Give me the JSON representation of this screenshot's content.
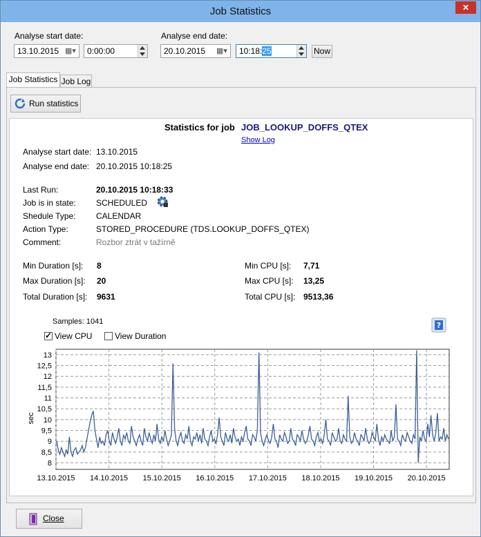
{
  "window": {
    "title": "Job Statistics",
    "close_glyph": "✕"
  },
  "filters": {
    "start_label": "Analyse start date:",
    "start_date": "13.10.2015",
    "start_time": "0:00:00",
    "end_label": "Analyse end date:",
    "end_date": "20.10.2015",
    "end_time_pre": "10:18:",
    "end_time_sel": "25",
    "now_label": "Now"
  },
  "tabs": [
    {
      "label": "Job Statistics"
    },
    {
      "label": "Job Log"
    }
  ],
  "toolbar": {
    "run_label": "Run statistics"
  },
  "stats": {
    "heading_prefix": "Statistics for job",
    "job_name": "JOB_LOOKUP_DOFFS_QTEX",
    "show_log": "Show Log",
    "rows": [
      {
        "label": "Analyse start date:",
        "value": "13.10.2015"
      },
      {
        "label": "Analyse end date:",
        "value": "20.10.2015 10:18:25"
      },
      {
        "label": "Last Run:",
        "value": "20.10.2015 10:18:33"
      },
      {
        "label": "Job is in state:",
        "value": "SCHEDULED"
      },
      {
        "label": "Shedule Type:",
        "value": "CALENDAR"
      },
      {
        "label": "Action Type:",
        "value": "STORED_PROCEDURE (TDS.LOOKUP_DOFFS_QTEX)"
      },
      {
        "label": "Comment:",
        "value": "Rozbor ztrát v tažírně"
      }
    ],
    "metrics": [
      {
        "label": "Min Duration [s]:",
        "value": "8"
      },
      {
        "label": "Max Duration [s]:",
        "value": "20"
      },
      {
        "label": "Total Duration [s]:",
        "value": "9631"
      },
      {
        "label": "Min CPU [s]:",
        "value": "7,71"
      },
      {
        "label": "Max CPU [s]:",
        "value": "13,25"
      },
      {
        "label": "Total CPU [s]:",
        "value": "9513,36"
      }
    ]
  },
  "samples_label": "Samples: 1041",
  "view_cpu_label": "View CPU",
  "view_cpu_checked": true,
  "view_duration_label": "View Duration",
  "view_duration_checked": false,
  "footer": {
    "close_label": "Close"
  },
  "colors": {
    "series": "#3a5f9a",
    "titlebar": "#7eb4ea",
    "link": "#0000cc"
  },
  "chart_data": {
    "type": "line",
    "ylabel": "sec",
    "ylim": [
      7.7,
      13.25
    ],
    "yticks": [
      "8",
      "8,5",
      "9",
      "9,5",
      "10",
      "10,5",
      "11",
      "11,5",
      "12",
      "12,5",
      "13"
    ],
    "x_dates": [
      "13.10.2015",
      "14.10.2015",
      "15.10.2015",
      "16.10.2015",
      "17.10.2015",
      "18.10.2015",
      "19.10.2015",
      "20.10.2015"
    ],
    "xlim": [
      "13.10.2015 00:00",
      "20.10.2015 10:18"
    ],
    "series": [
      {
        "values": [
          9.0,
          8.6,
          8.4,
          8.7,
          8.5,
          8.3,
          8.6,
          8.4,
          9.2,
          8.5,
          8.3,
          8.6,
          8.7,
          8.4,
          8.5,
          8.6,
          8.8,
          8.5,
          8.7,
          9.1,
          9.5,
          9.9,
          10.2,
          10.4,
          9.5,
          9.1,
          8.7,
          9.2,
          8.9,
          9.0,
          8.8,
          9.3,
          9.5,
          9.0,
          8.8,
          9.4,
          9.1,
          8.9,
          9.2,
          9.6,
          9.0,
          8.8,
          9.3,
          9.1,
          9.4,
          9.0,
          8.9,
          9.7,
          9.2,
          9.0,
          8.8,
          9.1,
          9.3,
          9.0,
          8.8,
          9.6,
          9.2,
          9.0,
          9.4,
          9.1,
          8.9,
          9.3,
          9.0,
          9.8,
          9.1,
          8.9,
          9.2,
          9.0,
          9.5,
          9.1,
          8.8,
          9.0,
          9.3,
          12.6,
          9.6,
          9.0,
          8.8,
          9.2,
          9.4,
          9.0,
          8.9,
          9.3,
          9.1,
          9.7,
          9.0,
          8.8,
          9.2,
          9.1,
          9.4,
          9.0,
          9.3,
          8.9,
          9.6,
          9.1,
          9.0,
          8.8,
          9.2,
          9.5,
          9.0,
          9.1,
          8.9,
          9.3,
          10.1,
          9.2,
          9.0,
          8.8,
          9.4,
          9.1,
          9.0,
          9.3,
          8.9,
          9.6,
          9.2,
          9.0,
          9.1,
          8.8,
          9.2,
          9.0,
          9.4,
          9.7,
          9.1,
          9.0,
          8.8,
          9.3,
          9.2,
          9.0,
          9.5,
          13.1,
          9.4,
          9.0,
          8.8,
          9.1,
          9.3,
          9.0,
          8.9,
          9.2,
          9.8,
          9.1,
          9.0,
          8.7,
          9.3,
          9.1,
          9.0,
          9.4,
          9.2,
          8.9,
          9.0,
          9.6,
          9.1,
          9.0,
          8.8,
          9.3,
          9.2,
          9.0,
          9.5,
          9.1,
          8.9,
          9.0,
          9.3,
          9.7,
          9.1,
          9.0,
          8.8,
          9.2,
          9.4,
          9.0,
          9.1,
          8.9,
          9.3,
          10.0,
          9.1,
          9.0,
          8.8,
          9.4,
          9.2,
          9.0,
          9.1,
          9.6,
          9.0,
          8.9,
          9.3,
          9.1,
          9.0,
          11.1,
          9.2,
          8.9,
          9.0,
          9.4,
          9.1,
          9.0,
          8.8,
          9.3,
          9.2,
          9.0,
          9.6,
          9.1,
          8.9,
          9.0,
          9.4,
          9.2,
          9.0,
          9.8,
          9.1,
          8.8,
          9.2,
          9.0,
          9.3,
          9.1,
          9.0,
          8.9,
          9.5,
          9.0,
          9.2,
          10.7,
          9.1,
          9.0,
          8.8,
          9.3,
          9.1,
          9.0,
          9.4,
          9.2,
          9.0,
          8.9,
          9.3,
          9.1,
          13.2,
          8.0,
          9.2,
          9.0,
          9.5,
          9.1,
          9.0,
          9.8,
          9.2,
          10.2,
          9.3,
          9.0,
          9.4,
          10.3,
          9.0,
          9.2,
          9.1,
          9.6,
          9.0,
          9.3,
          9.1
        ]
      }
    ]
  }
}
